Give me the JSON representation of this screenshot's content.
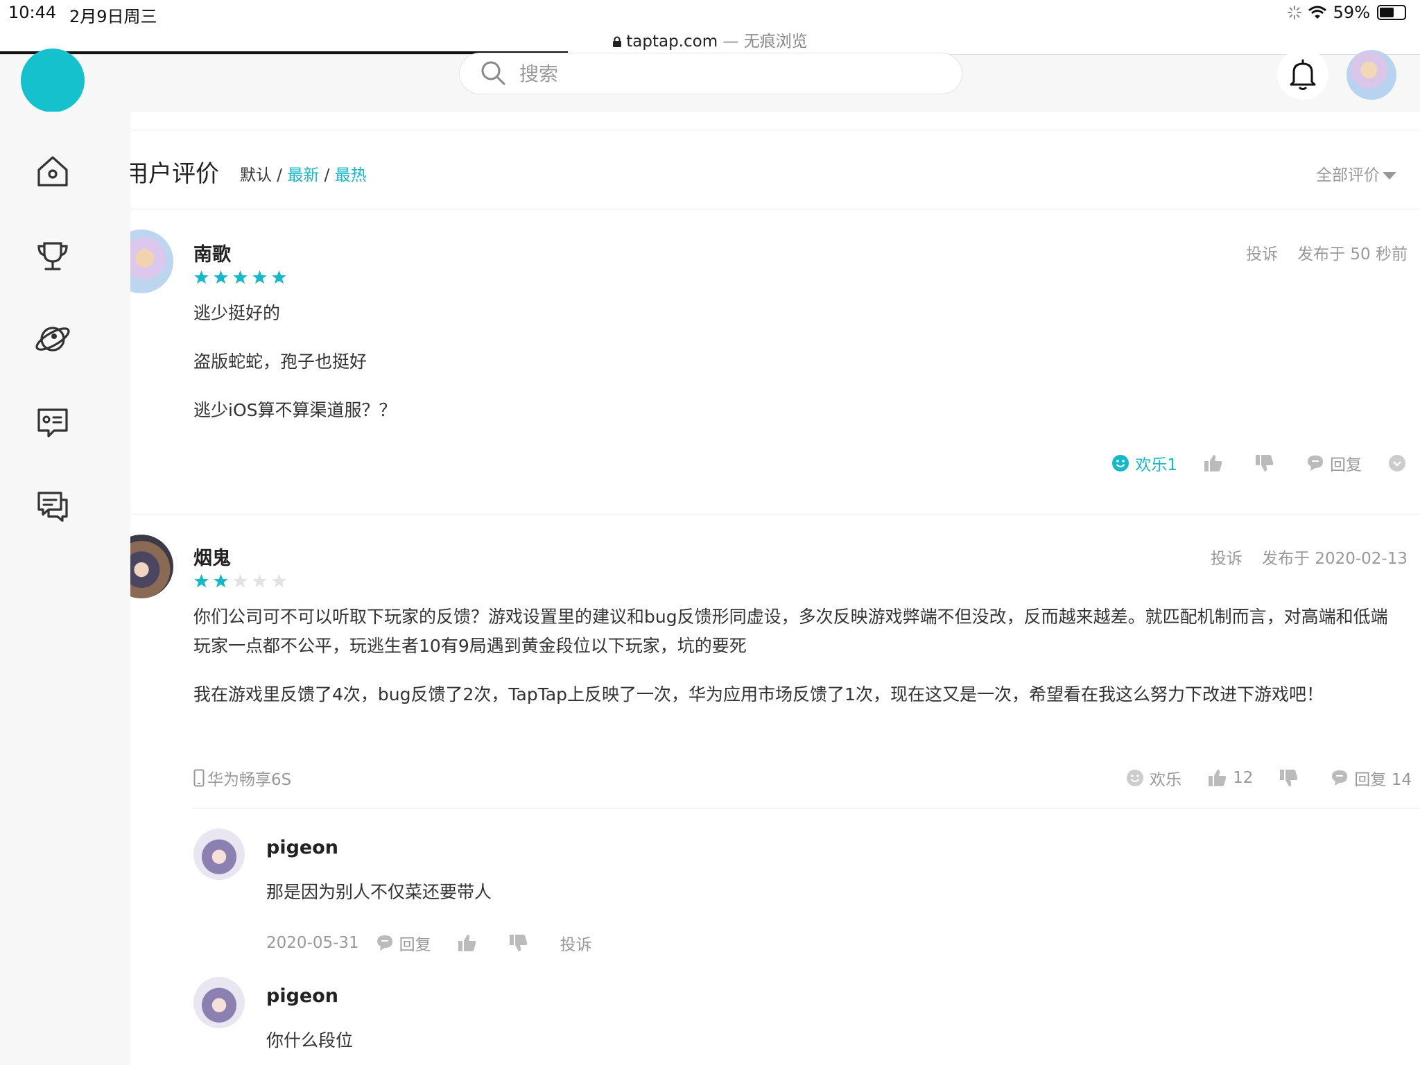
{
  "status_bar": {
    "time": "10:44",
    "date": "2月9日周三",
    "battery_text": "59%",
    "battery_level": 0.59
  },
  "browser": {
    "url": "taptap.com",
    "mode": " — 无痕浏览",
    "load_progress": 0.4
  },
  "search": {
    "placeholder": "搜索",
    "value": ""
  },
  "sidebar": {
    "items": [
      "home-icon",
      "trophy-icon",
      "planet-icon",
      "profile-card-icon",
      "chat-icon"
    ]
  },
  "section": {
    "title": "用户评价",
    "sort": {
      "default": "默认",
      "sep": " / ",
      "latest": "最新",
      "hot": "最热"
    },
    "filter": "全部评价"
  },
  "reviews": [
    {
      "user": "南歌",
      "rating": 5,
      "report": "投诉",
      "time": "发布于 50 秒前",
      "paragraphs": [
        "逃少挺好的",
        "盗版蛇蛇，孢子也挺好",
        "逃少iOS算不算渠道服？？"
      ],
      "actions": {
        "fun": "欢乐1",
        "reply": "回复"
      }
    },
    {
      "user": "烟鬼",
      "rating": 2,
      "report": "投诉",
      "time": "发布于 2020-02-13",
      "paragraphs": [
        "你们公司可不可以听取下玩家的反馈？游戏设置里的建议和bug反馈形同虚设，多次反映游戏弊端不但没改，反而越来越差。就匹配机制而言，对高端和低端玩家一点都不公平，玩逃生者10有9局遇到黄金段位以下玩家，坑的要死",
        "我在游戏里反馈了4次，bug反馈了2次，TapTap上反映了一次，华为应用市场反馈了1次，现在这又是一次，希望看在我这么努力下改进下游戏吧！"
      ],
      "device": "华为畅享6S",
      "actions": {
        "fun": "欢乐",
        "likes": "12",
        "reply": "回复 14"
      },
      "replies": [
        {
          "user": "pigeon",
          "text": "那是因为别人不仅菜还要带人",
          "date": "2020-05-31",
          "reply": "回复",
          "report": "投诉"
        },
        {
          "user": "pigeon",
          "text": "你什么段位"
        }
      ]
    }
  ],
  "colors": {
    "accent": "#14b9c8",
    "logo": "#14c1cc",
    "star_empty": "#e2e2e2"
  }
}
